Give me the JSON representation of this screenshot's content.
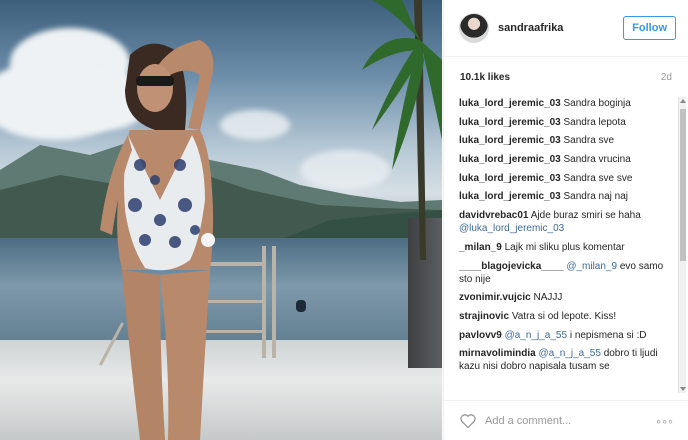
{
  "post": {
    "username": "sandraafrika",
    "follow_label": "Follow",
    "likes": "10.1k likes",
    "age": "2d",
    "add_comment_placeholder": "Add a comment...",
    "more_label": "◦◦◦"
  },
  "comments": [
    {
      "user": "luka_lord_jeremic_03",
      "text": "Sandra boginja"
    },
    {
      "user": "luka_lord_jeremic_03",
      "text": "Sandra lepota"
    },
    {
      "user": "luka_lord_jeremic_03",
      "text": "Sandra sve"
    },
    {
      "user": "luka_lord_jeremic_03",
      "text": "Sandra vrucina"
    },
    {
      "user": "luka_lord_jeremic_03",
      "text": "Sandra sve sve"
    },
    {
      "user": "luka_lord_jeremic_03",
      "text": "Sandra naj naj"
    },
    {
      "user": "davidvrebac01",
      "text": "Ajde buraz smiri se haha",
      "mention": "@luka_lord_jeremic_03",
      "after": ""
    },
    {
      "user": "_milan_9",
      "text": "Lajk mi sliku plus komentar"
    },
    {
      "user": "____blagojevicka____",
      "mention": "@_milan_9",
      "after": "evo samo sto nije"
    },
    {
      "user": "zvonimir.vujcic",
      "text": "NAJJJ"
    },
    {
      "user": "strajinovic",
      "text": "Vatra si od lepote. Kiss!"
    },
    {
      "user": "pavlovv9",
      "mention": "@a_n_j_a_55",
      "after": "i nepismena si :D"
    },
    {
      "user": "mirnavolimindia",
      "mention": "@a_n_j_a_55",
      "after": "dobro ti ljudi kazu nisi dobro napisala tusam se"
    }
  ],
  "colors": {
    "accent": "#3897f0",
    "mention": "#3e6a99",
    "muted": "#999999"
  },
  "icons": {
    "heart": "heart-icon",
    "more": "more-icon"
  }
}
